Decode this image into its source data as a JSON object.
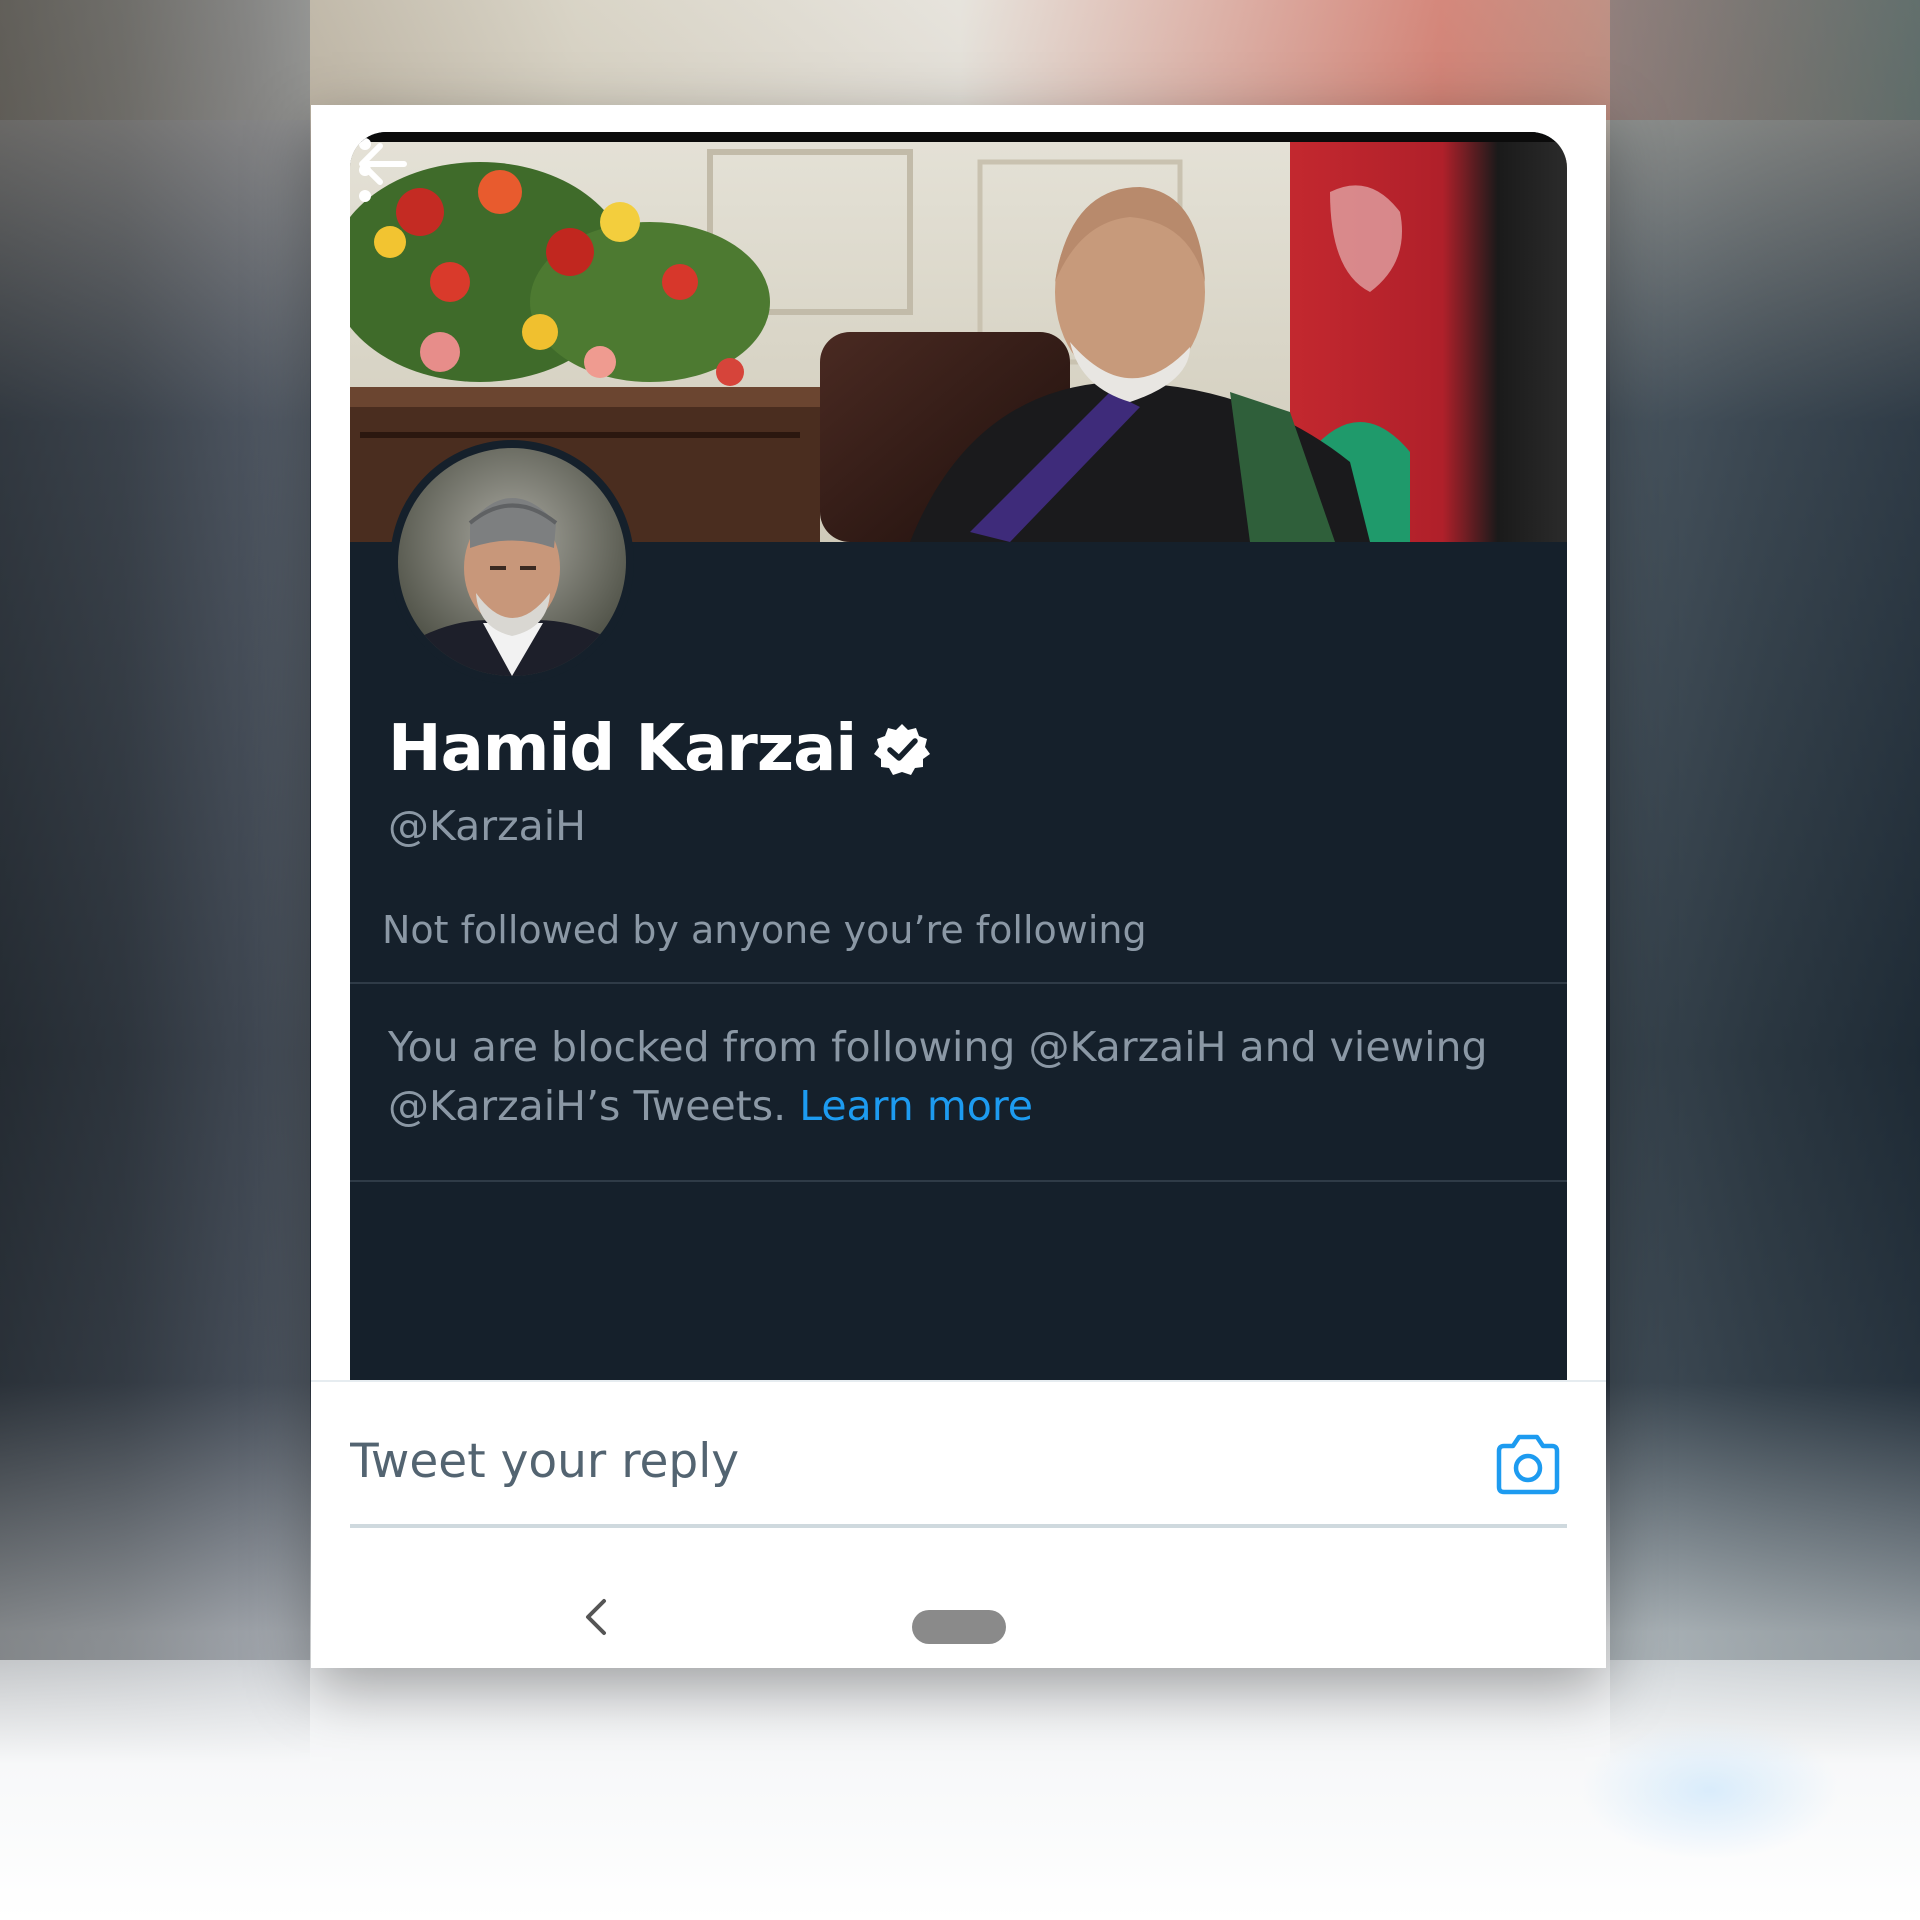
{
  "profile": {
    "display_name": "Hamid Karzai",
    "handle": "@KarzaiH",
    "followed_by": "Not followed by anyone you’re following",
    "blocked_message": "You are blocked from following @KarzaiH and viewing @KarzaiH’s Tweets.",
    "learn_more": "Learn more"
  },
  "reply": {
    "placeholder": "Tweet your reply"
  },
  "icons": {
    "back": "arrow-left-icon",
    "more": "more-vertical-icon",
    "verified": "verified-badge-icon",
    "camera": "camera-icon",
    "nav_back": "chevron-left-icon",
    "nav_home": "home-pill"
  },
  "colors": {
    "background": "#15202b",
    "accent": "#1d9bf0",
    "secondary_text": "#8b98a5"
  }
}
